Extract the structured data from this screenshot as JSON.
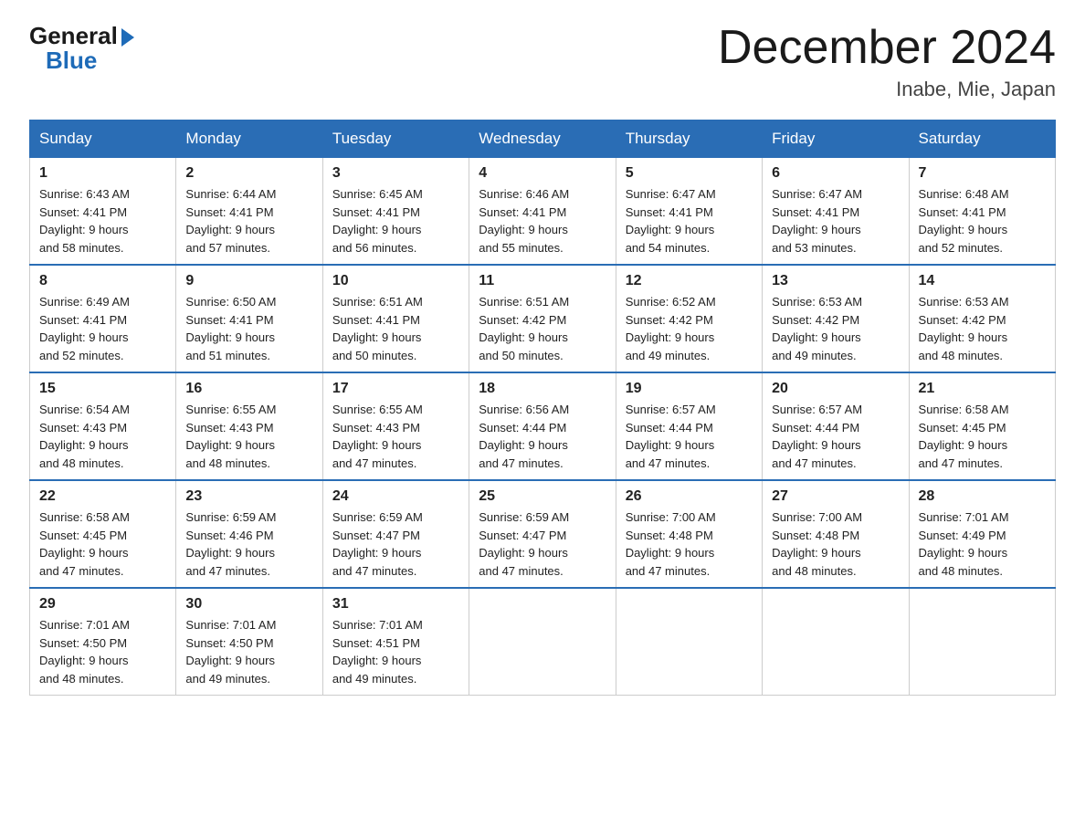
{
  "header": {
    "logo_general": "General",
    "logo_blue": "Blue",
    "title": "December 2024",
    "location": "Inabe, Mie, Japan"
  },
  "weekdays": [
    "Sunday",
    "Monday",
    "Tuesday",
    "Wednesday",
    "Thursday",
    "Friday",
    "Saturday"
  ],
  "weeks": [
    [
      {
        "day": "1",
        "sunrise": "6:43 AM",
        "sunset": "4:41 PM",
        "daylight": "9 hours and 58 minutes."
      },
      {
        "day": "2",
        "sunrise": "6:44 AM",
        "sunset": "4:41 PM",
        "daylight": "9 hours and 57 minutes."
      },
      {
        "day": "3",
        "sunrise": "6:45 AM",
        "sunset": "4:41 PM",
        "daylight": "9 hours and 56 minutes."
      },
      {
        "day": "4",
        "sunrise": "6:46 AM",
        "sunset": "4:41 PM",
        "daylight": "9 hours and 55 minutes."
      },
      {
        "day": "5",
        "sunrise": "6:47 AM",
        "sunset": "4:41 PM",
        "daylight": "9 hours and 54 minutes."
      },
      {
        "day": "6",
        "sunrise": "6:47 AM",
        "sunset": "4:41 PM",
        "daylight": "9 hours and 53 minutes."
      },
      {
        "day": "7",
        "sunrise": "6:48 AM",
        "sunset": "4:41 PM",
        "daylight": "9 hours and 52 minutes."
      }
    ],
    [
      {
        "day": "8",
        "sunrise": "6:49 AM",
        "sunset": "4:41 PM",
        "daylight": "9 hours and 52 minutes."
      },
      {
        "day": "9",
        "sunrise": "6:50 AM",
        "sunset": "4:41 PM",
        "daylight": "9 hours and 51 minutes."
      },
      {
        "day": "10",
        "sunrise": "6:51 AM",
        "sunset": "4:41 PM",
        "daylight": "9 hours and 50 minutes."
      },
      {
        "day": "11",
        "sunrise": "6:51 AM",
        "sunset": "4:42 PM",
        "daylight": "9 hours and 50 minutes."
      },
      {
        "day": "12",
        "sunrise": "6:52 AM",
        "sunset": "4:42 PM",
        "daylight": "9 hours and 49 minutes."
      },
      {
        "day": "13",
        "sunrise": "6:53 AM",
        "sunset": "4:42 PM",
        "daylight": "9 hours and 49 minutes."
      },
      {
        "day": "14",
        "sunrise": "6:53 AM",
        "sunset": "4:42 PM",
        "daylight": "9 hours and 48 minutes."
      }
    ],
    [
      {
        "day": "15",
        "sunrise": "6:54 AM",
        "sunset": "4:43 PM",
        "daylight": "9 hours and 48 minutes."
      },
      {
        "day": "16",
        "sunrise": "6:55 AM",
        "sunset": "4:43 PM",
        "daylight": "9 hours and 48 minutes."
      },
      {
        "day": "17",
        "sunrise": "6:55 AM",
        "sunset": "4:43 PM",
        "daylight": "9 hours and 47 minutes."
      },
      {
        "day": "18",
        "sunrise": "6:56 AM",
        "sunset": "4:44 PM",
        "daylight": "9 hours and 47 minutes."
      },
      {
        "day": "19",
        "sunrise": "6:57 AM",
        "sunset": "4:44 PM",
        "daylight": "9 hours and 47 minutes."
      },
      {
        "day": "20",
        "sunrise": "6:57 AM",
        "sunset": "4:44 PM",
        "daylight": "9 hours and 47 minutes."
      },
      {
        "day": "21",
        "sunrise": "6:58 AM",
        "sunset": "4:45 PM",
        "daylight": "9 hours and 47 minutes."
      }
    ],
    [
      {
        "day": "22",
        "sunrise": "6:58 AM",
        "sunset": "4:45 PM",
        "daylight": "9 hours and 47 minutes."
      },
      {
        "day": "23",
        "sunrise": "6:59 AM",
        "sunset": "4:46 PM",
        "daylight": "9 hours and 47 minutes."
      },
      {
        "day": "24",
        "sunrise": "6:59 AM",
        "sunset": "4:47 PM",
        "daylight": "9 hours and 47 minutes."
      },
      {
        "day": "25",
        "sunrise": "6:59 AM",
        "sunset": "4:47 PM",
        "daylight": "9 hours and 47 minutes."
      },
      {
        "day": "26",
        "sunrise": "7:00 AM",
        "sunset": "4:48 PM",
        "daylight": "9 hours and 47 minutes."
      },
      {
        "day": "27",
        "sunrise": "7:00 AM",
        "sunset": "4:48 PM",
        "daylight": "9 hours and 48 minutes."
      },
      {
        "day": "28",
        "sunrise": "7:01 AM",
        "sunset": "4:49 PM",
        "daylight": "9 hours and 48 minutes."
      }
    ],
    [
      {
        "day": "29",
        "sunrise": "7:01 AM",
        "sunset": "4:50 PM",
        "daylight": "9 hours and 48 minutes."
      },
      {
        "day": "30",
        "sunrise": "7:01 AM",
        "sunset": "4:50 PM",
        "daylight": "9 hours and 49 minutes."
      },
      {
        "day": "31",
        "sunrise": "7:01 AM",
        "sunset": "4:51 PM",
        "daylight": "9 hours and 49 minutes."
      },
      null,
      null,
      null,
      null
    ]
  ],
  "labels": {
    "sunrise": "Sunrise:",
    "sunset": "Sunset:",
    "daylight": "Daylight:"
  }
}
